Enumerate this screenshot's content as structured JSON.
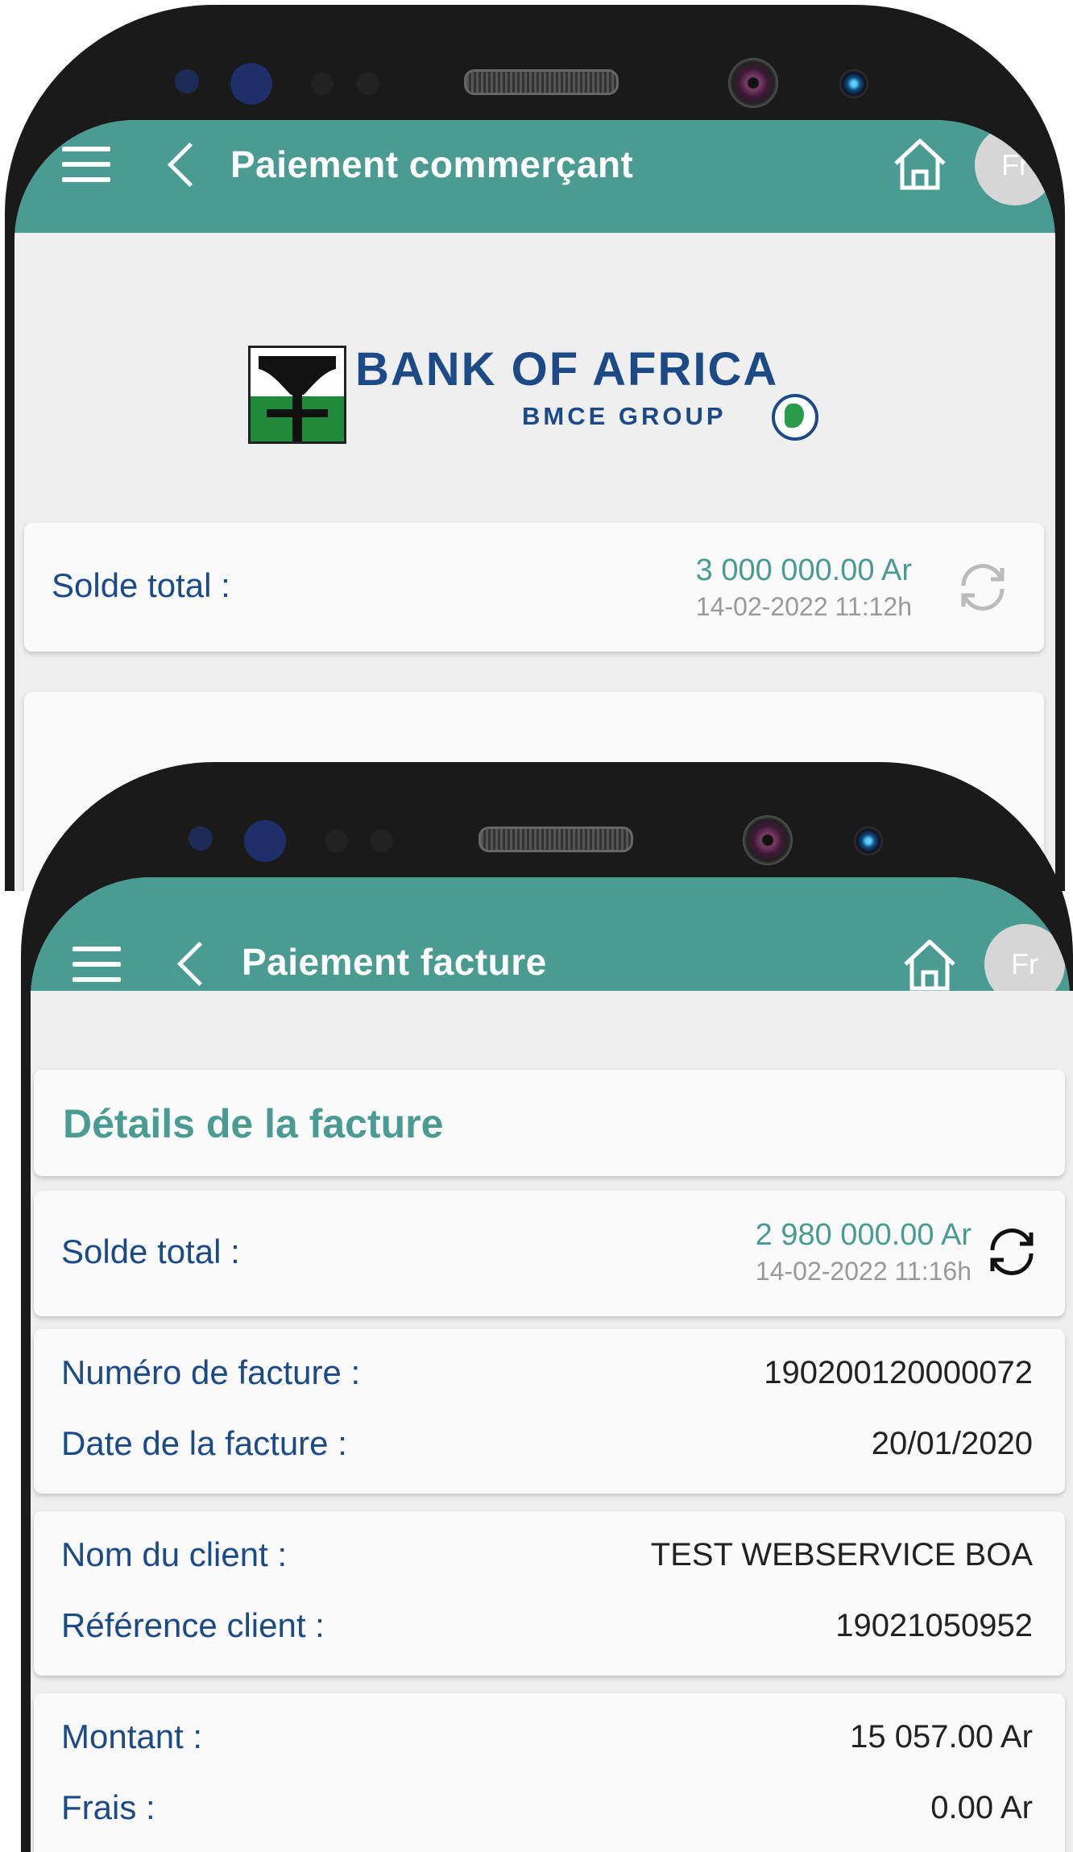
{
  "back_screen": {
    "header": {
      "title": "Paiement commerçant",
      "lang": "Fr"
    },
    "logo": {
      "main": "BANK OF AFRICA",
      "sub": "BMCE GROUP"
    },
    "balance": {
      "label": "Solde total :",
      "amount": "3 000 000.00 Ar",
      "date": "14-02-2022 11:12h"
    }
  },
  "front_screen": {
    "header": {
      "title": "Paiement facture",
      "lang": "Fr"
    },
    "section_title": "Détails de la facture",
    "balance": {
      "label": "Solde total :",
      "amount": "2 980 000.00 Ar",
      "date": "14-02-2022 11:16h"
    },
    "invoice": {
      "number_label": "Numéro de facture :",
      "number_value": "190200120000072",
      "date_label": "Date de la facture :",
      "date_value": "20/01/2020"
    },
    "client": {
      "name_label": "Nom du client :",
      "name_value": "TEST WEBSERVICE BOA",
      "ref_label": "Référence client :",
      "ref_value": "19021050952"
    },
    "payment": {
      "amount_label": "Montant :",
      "amount_value": "15 057.00 Ar",
      "fees_label": "Frais :",
      "fees_value": "0.00 Ar"
    }
  },
  "colors": {
    "header": "#4a9b91",
    "label": "#1c4a86",
    "accent": "#4a9b91"
  },
  "icons": [
    "menu-icon",
    "back-icon",
    "home-icon",
    "refresh-icon",
    "globe-icon"
  ]
}
